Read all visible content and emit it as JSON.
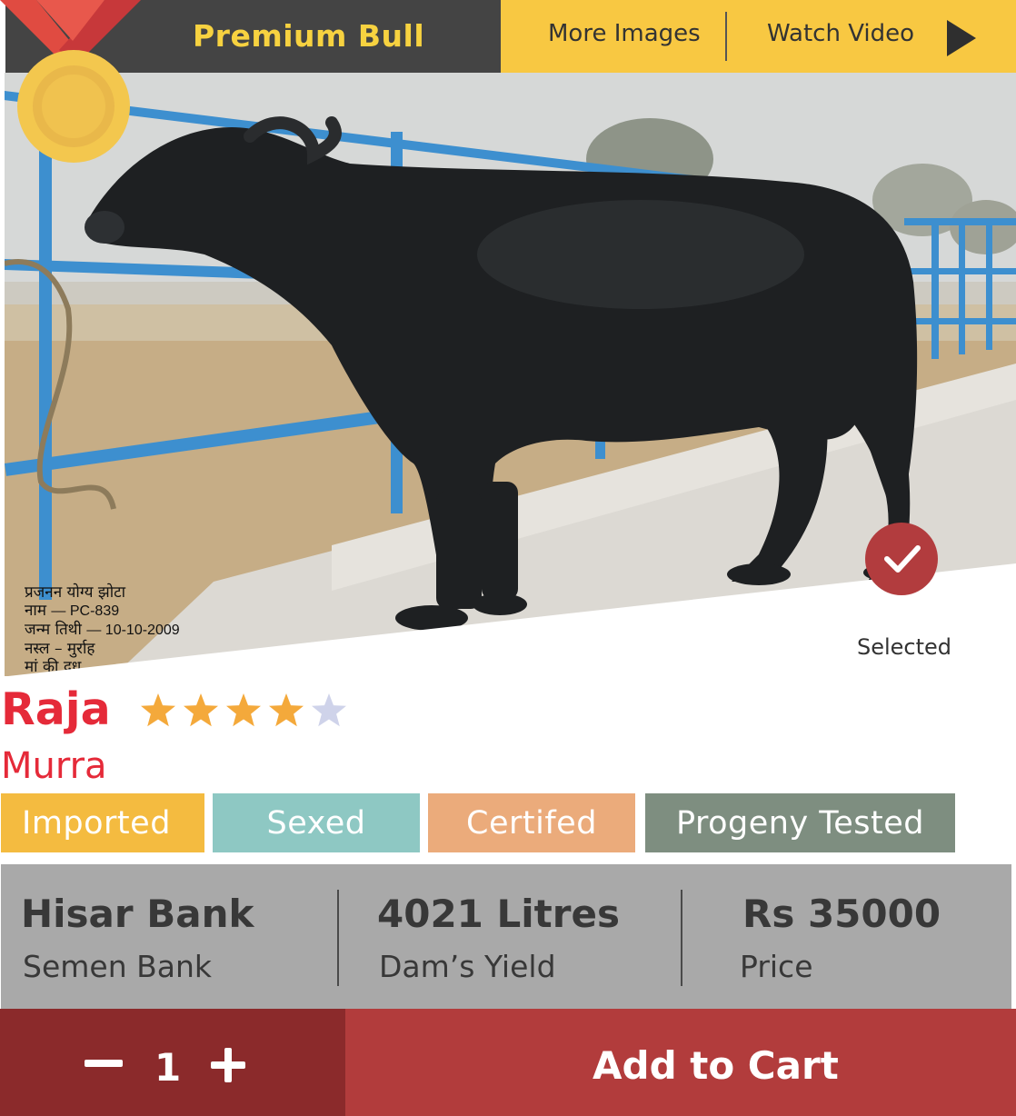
{
  "header": {
    "title": "Premium Bull",
    "more_images": "More Images",
    "watch_video": "Watch Video"
  },
  "photo": {
    "caption": {
      "line1": "प्रजनन योग्य झोटा",
      "line2_label": "नाम",
      "line2_value": "— PC-839",
      "line3_label": "जन्म तिथी",
      "line3_value": "— 10-10-2009",
      "line4": "नस्ल – मुर्राह",
      "line5": "मां की दूध"
    }
  },
  "selected_label": "Selected",
  "animal": {
    "name": "Raja",
    "breed": "Murra",
    "rating": 4,
    "rating_max": 5
  },
  "tags": {
    "imported": "Imported",
    "sexed": "Sexed",
    "certified": "Certifed",
    "progeny": "Progeny Tested"
  },
  "info": {
    "bank_value": "Hisar Bank",
    "bank_label": "Semen Bank",
    "yield_value": "4021 Litres",
    "yield_label": "Dam’s Yield",
    "price_value": "Rs 35000",
    "price_label": "Price"
  },
  "cart": {
    "quantity": "1",
    "add_label": "Add to Cart"
  },
  "colors": {
    "accent_red": "#e52a39",
    "header_dark": "#444444",
    "header_yellow": "#f8c842",
    "cart_dark": "#8b2a2b",
    "cart_red": "#b23c3c",
    "star_on": "#f4a93b",
    "star_off": "#cfd3ea"
  }
}
